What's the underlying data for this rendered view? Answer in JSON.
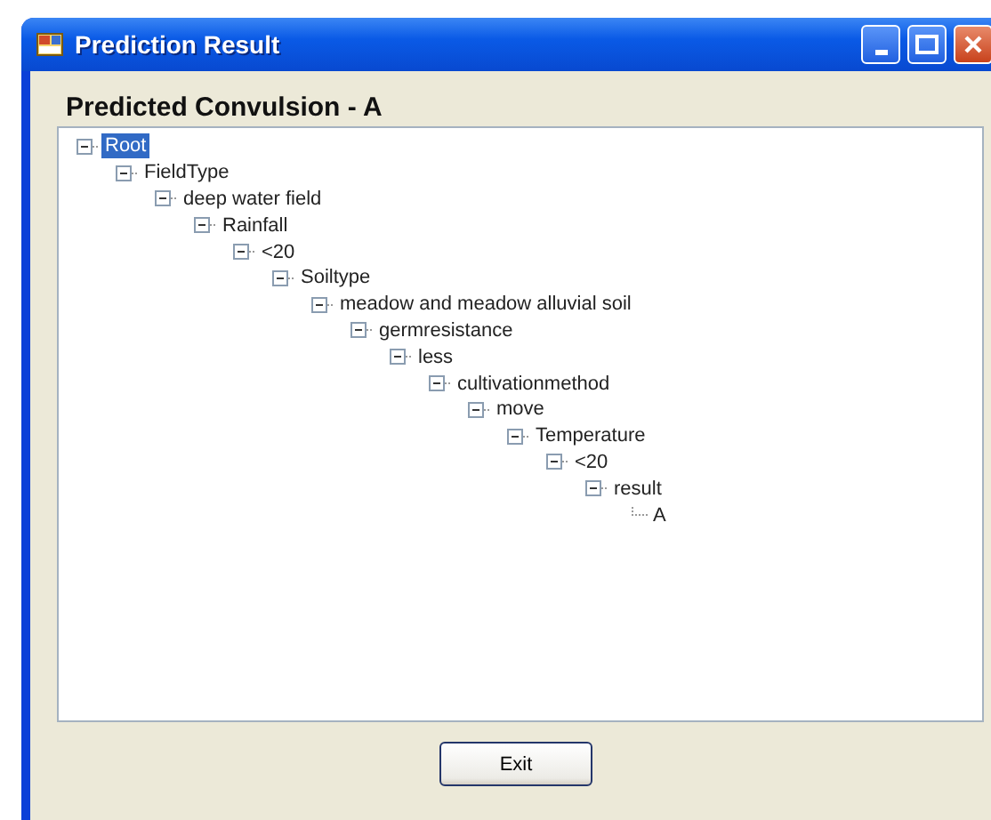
{
  "window": {
    "title": "Prediction Result"
  },
  "heading": "Predicted Convulsion - A",
  "tree": [
    {
      "label": "Root",
      "selected": true,
      "expanded": true,
      "children": [
        {
          "label": "FieldType",
          "selected": false,
          "expanded": true,
          "children": [
            {
              "label": "deep water field",
              "selected": false,
              "expanded": true,
              "children": [
                {
                  "label": "Rainfall",
                  "selected": false,
                  "expanded": true,
                  "children": [
                    {
                      "label": "<20",
                      "selected": false,
                      "expanded": true,
                      "children": [
                        {
                          "label": "Soiltype",
                          "selected": false,
                          "expanded": true,
                          "children": [
                            {
                              "label": "meadow and meadow alluvial soil",
                              "selected": false,
                              "expanded": true,
                              "children": [
                                {
                                  "label": "germresistance",
                                  "selected": false,
                                  "expanded": true,
                                  "children": [
                                    {
                                      "label": "less",
                                      "selected": false,
                                      "expanded": true,
                                      "children": [
                                        {
                                          "label": "cultivationmethod",
                                          "selected": false,
                                          "expanded": true,
                                          "children": [
                                            {
                                              "label": "move",
                                              "selected": false,
                                              "expanded": true,
                                              "children": [
                                                {
                                                  "label": "Temperature",
                                                  "selected": false,
                                                  "expanded": true,
                                                  "children": [
                                                    {
                                                      "label": "<20",
                                                      "selected": false,
                                                      "expanded": true,
                                                      "children": [
                                                        {
                                                          "label": "result",
                                                          "selected": false,
                                                          "expanded": true,
                                                          "children": [
                                                            {
                                                              "label": "A",
                                                              "selected": false
                                                            }
                                                          ]
                                                        }
                                                      ]
                                                    }
                                                  ]
                                                }
                                              ]
                                            }
                                          ]
                                        }
                                      ]
                                    }
                                  ]
                                }
                              ]
                            }
                          ]
                        }
                      ]
                    }
                  ]
                }
              ]
            }
          ]
        }
      ]
    }
  ],
  "buttons": [
    "Exit"
  ]
}
